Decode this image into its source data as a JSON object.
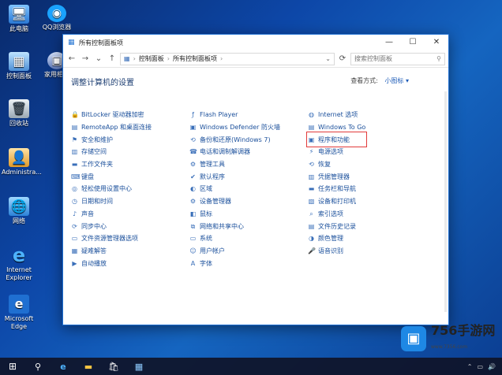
{
  "desktop": {
    "icons": [
      {
        "label": "此电脑",
        "glyph": "🖥",
        "icon": "this-pc-icon"
      },
      {
        "label": "控制面板",
        "glyph": "▦",
        "icon": "control-panel-icon"
      },
      {
        "label": "回收站",
        "glyph": "🗑",
        "icon": "recycle-bin-icon"
      },
      {
        "label": "Administra...",
        "glyph": "👤",
        "icon": "user-folder-icon"
      },
      {
        "label": "网络",
        "glyph": "🌐",
        "icon": "network-icon"
      },
      {
        "label": "Internet Explorer",
        "glyph": "e",
        "icon": "internet-explorer-icon"
      },
      {
        "label": "Microsoft Edge",
        "glyph": "e",
        "icon": "microsoft-edge-icon"
      }
    ],
    "icons2": [
      {
        "label": "QQ浏览器",
        "glyph": "◉",
        "icon": "qq-browser-icon"
      },
      {
        "label": "家用相机",
        "glyph": "▣",
        "icon": "camera-app-icon"
      }
    ]
  },
  "window": {
    "title": "所有控制面板项",
    "controls": {
      "minimize": "—",
      "maximize": "☐",
      "close": "✕"
    },
    "nav": {
      "back": "←",
      "forward": "→",
      "recent": "⌄",
      "up": "↑"
    },
    "breadcrumb": [
      "控制面板",
      "所有控制面板项"
    ],
    "search_placeholder": "搜索控制面板",
    "heading": "调整计算机的设置",
    "view_by_label": "查看方式:",
    "view_by_value": "小图标 ▾"
  },
  "columns": [
    [
      {
        "label": "BitLocker 驱动器加密",
        "glyph": "🔒",
        "icon": "bitlocker-icon"
      },
      {
        "label": "RemoteApp 和桌面连接",
        "glyph": "▤",
        "icon": "remoteapp-icon"
      },
      {
        "label": "安全和维护",
        "glyph": "⚑",
        "icon": "security-flag-icon"
      },
      {
        "label": "存储空间",
        "glyph": "▥",
        "icon": "storage-spaces-icon"
      },
      {
        "label": "工作文件夹",
        "glyph": "▬",
        "icon": "work-folders-icon"
      },
      {
        "label": "键盘",
        "glyph": "⌨",
        "icon": "keyboard-icon"
      },
      {
        "label": "轻松使用设置中心",
        "glyph": "◎",
        "icon": "ease-of-access-icon"
      },
      {
        "label": "日期和时间",
        "glyph": "◷",
        "icon": "date-time-icon"
      },
      {
        "label": "声音",
        "glyph": "♪",
        "icon": "sound-icon"
      },
      {
        "label": "同步中心",
        "glyph": "⟳",
        "icon": "sync-center-icon"
      },
      {
        "label": "文件资源管理器选项",
        "glyph": "▭",
        "icon": "file-explorer-options-icon"
      },
      {
        "label": "疑难解答",
        "glyph": "▦",
        "icon": "troubleshooting-icon"
      },
      {
        "label": "自动播放",
        "glyph": "▶",
        "icon": "autoplay-icon"
      }
    ],
    [
      {
        "label": "Flash Player",
        "glyph": "ƒ",
        "icon": "flash-player-icon"
      },
      {
        "label": "Windows Defender 防火墙",
        "glyph": "▣",
        "icon": "firewall-icon"
      },
      {
        "label": "备份和还原(Windows 7)",
        "glyph": "⟲",
        "icon": "backup-restore-icon"
      },
      {
        "label": "电话和调制解调器",
        "glyph": "☎",
        "icon": "phone-modem-icon"
      },
      {
        "label": "管理工具",
        "glyph": "⚙",
        "icon": "admin-tools-icon"
      },
      {
        "label": "默认程序",
        "glyph": "✔",
        "icon": "default-programs-icon"
      },
      {
        "label": "区域",
        "glyph": "◐",
        "icon": "region-icon"
      },
      {
        "label": "设备管理器",
        "glyph": "⚙",
        "icon": "device-manager-icon"
      },
      {
        "label": "鼠标",
        "glyph": "◧",
        "icon": "mouse-icon"
      },
      {
        "label": "网络和共享中心",
        "glyph": "⧉",
        "icon": "network-sharing-icon"
      },
      {
        "label": "系统",
        "glyph": "▭",
        "icon": "system-icon"
      },
      {
        "label": "用户帐户",
        "glyph": "☺",
        "icon": "user-accounts-icon"
      },
      {
        "label": "字体",
        "glyph": "A",
        "icon": "fonts-icon"
      }
    ],
    [
      {
        "label": "Internet 选项",
        "glyph": "◍",
        "icon": "internet-options-icon"
      },
      {
        "label": "Windows To Go",
        "glyph": "▤",
        "icon": "windows-to-go-icon"
      },
      {
        "label": "程序和功能",
        "glyph": "▣",
        "icon": "programs-features-icon"
      },
      {
        "label": "电源选项",
        "glyph": "⚡",
        "icon": "power-options-icon"
      },
      {
        "label": "恢复",
        "glyph": "⟲",
        "icon": "recovery-icon"
      },
      {
        "label": "凭据管理器",
        "glyph": "▥",
        "icon": "credential-manager-icon"
      },
      {
        "label": "任务栏和导航",
        "glyph": "▬",
        "icon": "taskbar-navigation-icon"
      },
      {
        "label": "设备和打印机",
        "glyph": "▧",
        "icon": "devices-printers-icon"
      },
      {
        "label": "索引选项",
        "glyph": "⌕",
        "icon": "indexing-options-icon"
      },
      {
        "label": "文件历史记录",
        "glyph": "▤",
        "icon": "file-history-icon"
      },
      {
        "label": "颜色管理",
        "glyph": "◑",
        "icon": "color-management-icon"
      },
      {
        "label": "语音识别",
        "glyph": "🎤",
        "icon": "speech-recognition-icon"
      }
    ]
  ],
  "taskbar": {
    "start": "⊞",
    "search": "⚲",
    "edge": "e",
    "explorer": "▬",
    "store": "🛍",
    "control_panel": "▦",
    "tray": [
      "⌃",
      "▭",
      "🔊"
    ]
  },
  "watermark": {
    "logo": "▣",
    "text": "756手游网",
    "sub": "www.7356.com"
  }
}
